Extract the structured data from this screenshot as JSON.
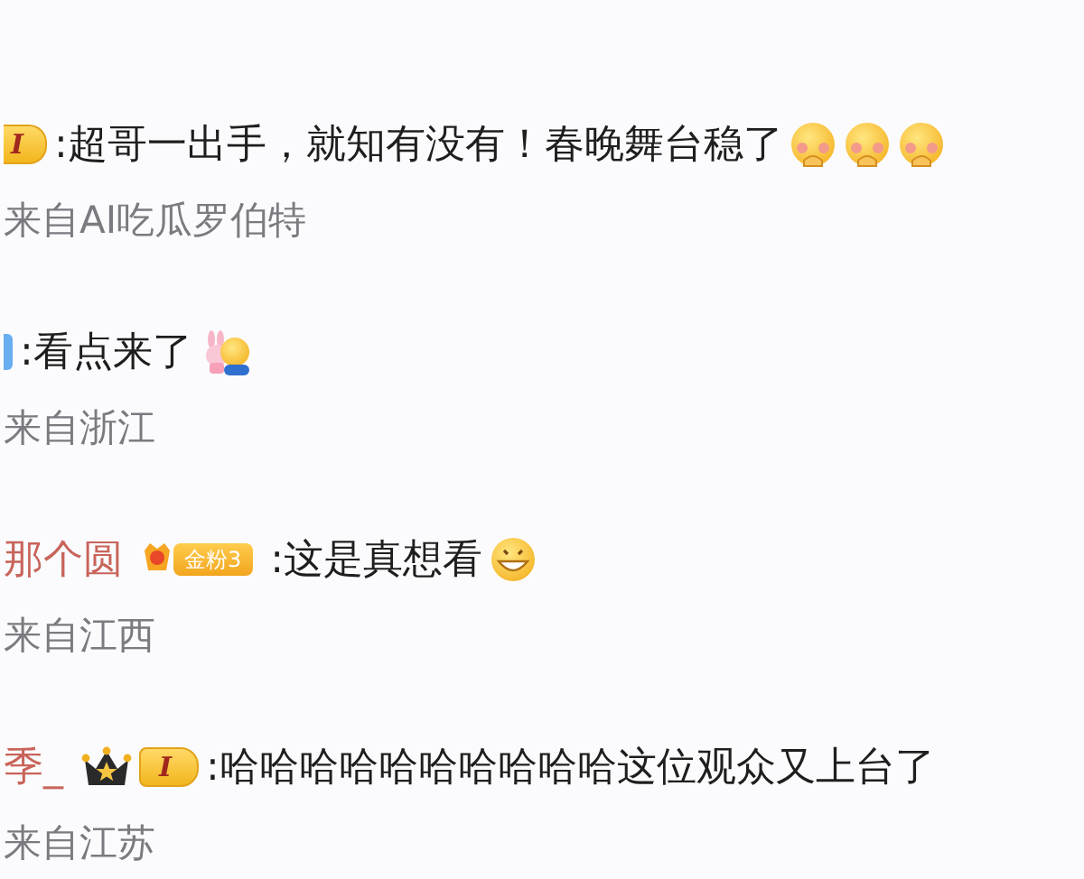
{
  "comments": [
    {
      "badges": [
        {
          "kind": "level-cut",
          "text": "I"
        }
      ],
      "text": ":超哥一出手，就知有没有！春晚舞台稳了",
      "emojis": [
        {
          "kind": "flushed"
        },
        {
          "kind": "flushed"
        },
        {
          "kind": "flushed"
        }
      ],
      "source": "来自AI吃瓜罗伯特"
    },
    {
      "badges": [
        {
          "kind": "blue-cut"
        }
      ],
      "text": ":看点来了",
      "emojis": [
        {
          "kind": "bunny-hug"
        }
      ],
      "source": "来自浙江"
    },
    {
      "username": "那个圆",
      "badges": [
        {
          "kind": "fan",
          "text": "金粉3"
        }
      ],
      "text": ":这是真想看",
      "emojis": [
        {
          "kind": "grin"
        }
      ],
      "source": "来自江西"
    },
    {
      "username": "季_",
      "badges": [
        {
          "kind": "crown"
        },
        {
          "kind": "level",
          "text": "I"
        }
      ],
      "text": ":哈哈哈哈哈哈哈哈哈哈这位观众又上台了",
      "source": "来自江苏"
    }
  ]
}
